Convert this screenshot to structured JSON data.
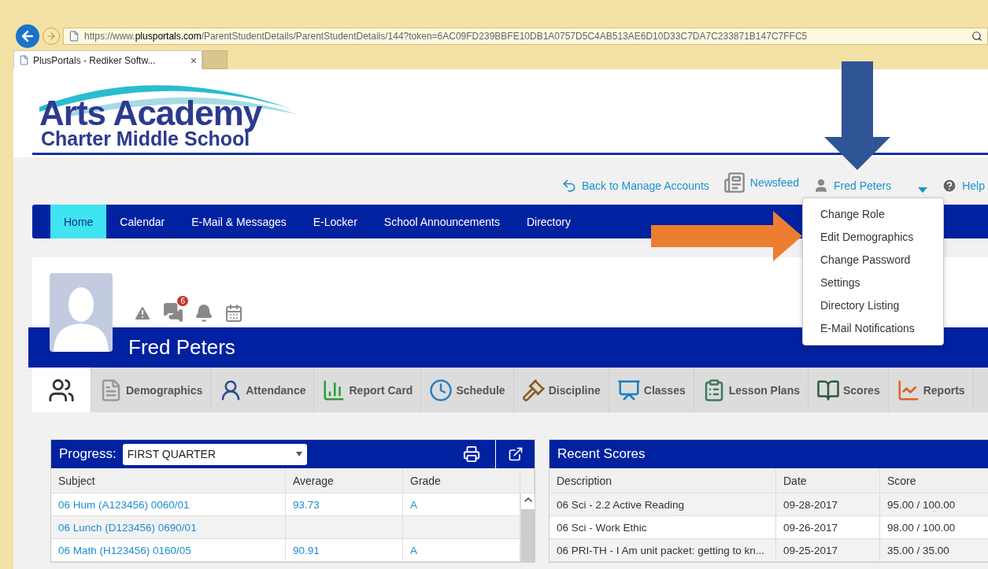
{
  "browser": {
    "url": "https://www.**plusportals.com**/ParentStudentDetails/ParentStudentDetails/144?token=6AC09FD239BBFE10DB1A0757D5C4AB513AE6D10D33C7DA7C233871B147C7FFC5",
    "tab_title": "PlusPortals - Rediker Softw...",
    "tab_close": "×"
  },
  "logo": {
    "line_1": "Arts Academy",
    "line_2": "Charter Middle School"
  },
  "top_links": [
    {
      "kind": "back",
      "label": "Back to Manage Accounts"
    },
    {
      "kind": "newsfeed",
      "label": "Newsfeed"
    },
    {
      "kind": "user",
      "label": "Fred Peters"
    },
    {
      "kind": "help",
      "label": "Help"
    }
  ],
  "user_menu": {
    "expanded": true,
    "items": [
      "Change Role",
      "Edit Demographics",
      "Change Password",
      "Settings",
      "Directory Listing",
      "E-Mail Notifications"
    ]
  },
  "nav": [
    {
      "label": "Home",
      "selected": true
    },
    {
      "label": "Calendar",
      "selected": false
    },
    {
      "label": "E-Mail & Messages",
      "selected": false
    },
    {
      "label": "E-Locker",
      "selected": false
    },
    {
      "label": "School Announcements",
      "selected": false
    },
    {
      "label": "Directory",
      "selected": false
    }
  ],
  "profile": {
    "name": "Fred Peters",
    "message_count": "6"
  },
  "tabs": [
    {
      "kind": "family",
      "selected": true
    },
    {
      "kind": "demographics",
      "label": "Demographics",
      "selected": false
    },
    {
      "kind": "attendance",
      "label": "Attendance",
      "selected": false
    },
    {
      "kind": "reportcard",
      "label": "Report Card",
      "selected": false
    },
    {
      "kind": "schedule",
      "label": "Schedule",
      "selected": false
    },
    {
      "kind": "discipline",
      "label": "Discipline",
      "selected": false
    },
    {
      "kind": "classes",
      "label": "Classes",
      "selected": false
    },
    {
      "kind": "lessons",
      "label": "Lesson Plans",
      "selected": false
    },
    {
      "kind": "scores",
      "label": "Scores",
      "selected": false
    },
    {
      "kind": "reports",
      "label": "Reports",
      "selected": false
    }
  ],
  "progress": {
    "label": "Progress:",
    "period": "FIRST QUARTER",
    "columns": [
      "Subject",
      "Average",
      "Grade"
    ],
    "rows": [
      [
        "06 Hum (A123456) 0060/01",
        "93.73",
        "A"
      ],
      [
        "06 Lunch (D123456) 0690/01",
        "",
        ""
      ],
      [
        "06 Math (H123456) 0160/05",
        "90.91",
        "A"
      ]
    ]
  },
  "recent_scores": {
    "title": "Recent Scores",
    "columns": [
      "Description",
      "Date",
      "Score"
    ],
    "rows": [
      [
        "06 Sci - 2.2 Active Reading",
        "09-28-2017",
        "95.00 / 100.00"
      ],
      [
        "06 Sci - Work Ethic",
        "09-26-2017",
        "98.00 / 100.00"
      ],
      [
        "06 PRI-TH - I Am unit packet: getting to kn...",
        "09-25-2017",
        "35.00 / 35.00"
      ]
    ]
  }
}
